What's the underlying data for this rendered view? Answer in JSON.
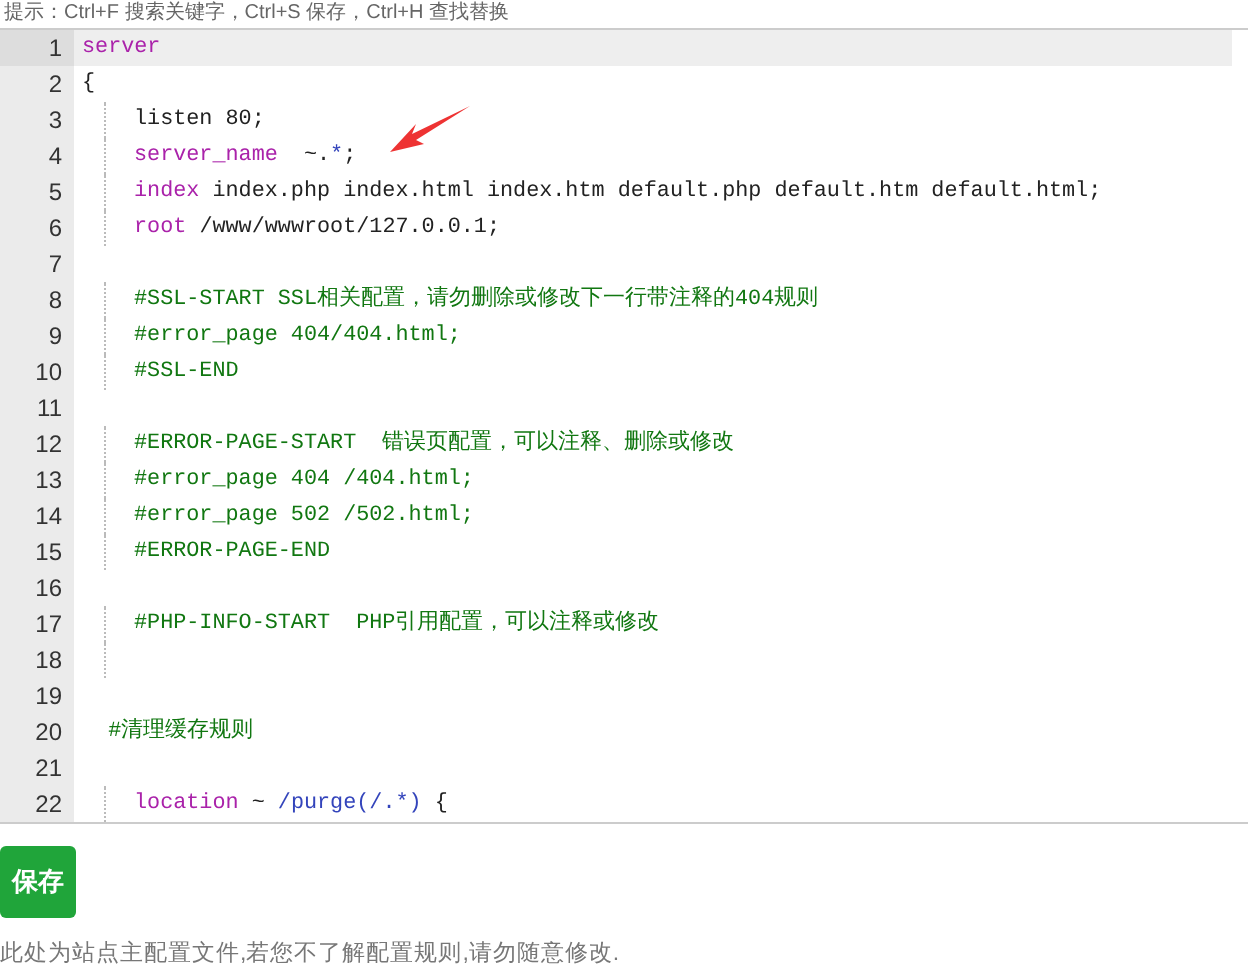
{
  "hint": "提示：Ctrl+F 搜索关键字，Ctrl+S 保存，Ctrl+H 查找替换",
  "editor": {
    "lines": [
      {
        "number": "1",
        "active": true,
        "guide": false,
        "tokens": [
          {
            "kind": "keyword",
            "text": "server"
          }
        ]
      },
      {
        "number": "2",
        "active": false,
        "guide": false,
        "tokens": [
          {
            "kind": "plain",
            "text": "{"
          }
        ]
      },
      {
        "number": "3",
        "active": false,
        "guide": true,
        "tokens": [
          {
            "kind": "plain",
            "text": "listen 80;"
          }
        ]
      },
      {
        "number": "4",
        "active": false,
        "guide": true,
        "tokens": [
          {
            "kind": "keyword",
            "text": "server_name"
          },
          {
            "kind": "plain",
            "text": "  ~."
          },
          {
            "kind": "regex",
            "text": "*"
          },
          {
            "kind": "plain",
            "text": ";"
          }
        ]
      },
      {
        "number": "5",
        "active": false,
        "guide": true,
        "tokens": [
          {
            "kind": "keyword",
            "text": "index"
          },
          {
            "kind": "plain",
            "text": " index.php index.html index.htm default.php default.htm default.html;"
          }
        ]
      },
      {
        "number": "6",
        "active": false,
        "guide": true,
        "tokens": [
          {
            "kind": "keyword",
            "text": "root"
          },
          {
            "kind": "plain",
            "text": " /www/wwwroot/127.0.0.1;"
          }
        ]
      },
      {
        "number": "7",
        "active": false,
        "guide": false
      },
      {
        "number": "8",
        "active": false,
        "guide": true,
        "tokens": [
          {
            "kind": "comment",
            "text": "#SSL-START SSL相关配置，请勿删除或修改下一行带注释的404规则"
          }
        ]
      },
      {
        "number": "9",
        "active": false,
        "guide": true,
        "tokens": [
          {
            "kind": "comment",
            "text": "#error_page 404/404.html;"
          }
        ]
      },
      {
        "number": "10",
        "active": false,
        "guide": true,
        "tokens": [
          {
            "kind": "comment",
            "text": "#SSL-END"
          }
        ]
      },
      {
        "number": "11",
        "active": false,
        "guide": false
      },
      {
        "number": "12",
        "active": false,
        "guide": true,
        "tokens": [
          {
            "kind": "comment",
            "text": "#ERROR-PAGE-START  错误页配置，可以注释、删除或修改"
          }
        ]
      },
      {
        "number": "13",
        "active": false,
        "guide": true,
        "tokens": [
          {
            "kind": "comment",
            "text": "#error_page 404 /404.html;"
          }
        ]
      },
      {
        "number": "14",
        "active": false,
        "guide": true,
        "tokens": [
          {
            "kind": "comment",
            "text": "#error_page 502 /502.html;"
          }
        ]
      },
      {
        "number": "15",
        "active": false,
        "guide": true,
        "tokens": [
          {
            "kind": "comment",
            "text": "#ERROR-PAGE-END"
          }
        ]
      },
      {
        "number": "16",
        "active": false,
        "guide": false
      },
      {
        "number": "17",
        "active": false,
        "guide": true,
        "tokens": [
          {
            "kind": "comment",
            "text": "#PHP-INFO-START  PHP引用配置，可以注释或修改"
          }
        ]
      },
      {
        "number": "18",
        "active": false,
        "guide": true
      },
      {
        "number": "19",
        "active": false,
        "guide": false
      },
      {
        "number": "20",
        "active": false,
        "guide": false,
        "tokens": [
          {
            "kind": "comment",
            "text": "  #清理缓存规则"
          }
        ]
      },
      {
        "number": "21",
        "active": false,
        "guide": false
      },
      {
        "number": "22",
        "active": false,
        "guide": true,
        "tokens": [
          {
            "kind": "keyword",
            "text": "location"
          },
          {
            "kind": "plain",
            "text": " ~ "
          },
          {
            "kind": "regex",
            "text": "/purge(/.*)"
          },
          {
            "kind": "plain",
            "text": " {"
          }
        ]
      }
    ]
  },
  "save_button": "保存",
  "note": "此处为站点主配置文件,若您不了解配置规则,请勿随意修改."
}
